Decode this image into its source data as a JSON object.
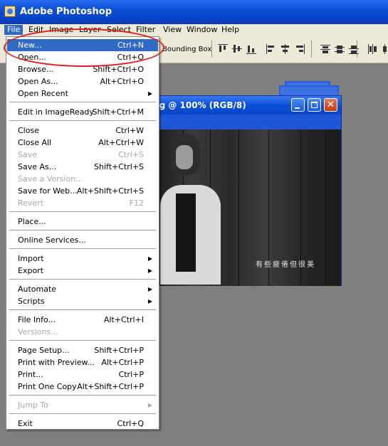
{
  "window": {
    "title": "Adobe Photoshop"
  },
  "menubar": [
    {
      "label": "File"
    },
    {
      "label": "Edit"
    },
    {
      "label": "Image"
    },
    {
      "label": "Layer"
    },
    {
      "label": "Select"
    },
    {
      "label": "Filter"
    },
    {
      "label": "View"
    },
    {
      "label": "Window"
    },
    {
      "label": "Help"
    }
  ],
  "options_bar": {
    "bounding_box_label": "Bounding Box"
  },
  "document": {
    "title": "pg @ 100% (RGB/8)",
    "caption": "有些疲倦但很美"
  },
  "file_menu": [
    {
      "label": "New...",
      "shortcut": "Ctrl+N"
    },
    {
      "label": "Open...",
      "shortcut": "Ctrl+O"
    },
    {
      "label": "Browse...",
      "shortcut": "Shift+Ctrl+O"
    },
    {
      "label": "Open As...",
      "shortcut": "Alt+Ctrl+O"
    },
    {
      "label": "Open Recent",
      "shortcut": ""
    },
    {
      "label": "Edit in ImageReady",
      "shortcut": "Shift+Ctrl+M"
    },
    {
      "label": "Close",
      "shortcut": "Ctrl+W"
    },
    {
      "label": "Close All",
      "shortcut": "Alt+Ctrl+W"
    },
    {
      "label": "Save",
      "shortcut": "Ctrl+S"
    },
    {
      "label": "Save As...",
      "shortcut": "Shift+Ctrl+S"
    },
    {
      "label": "Save a Version...",
      "shortcut": ""
    },
    {
      "label": "Save for Web...",
      "shortcut": "Alt+Shift+Ctrl+S"
    },
    {
      "label": "Revert",
      "shortcut": "F12"
    },
    {
      "label": "Place...",
      "shortcut": ""
    },
    {
      "label": "Online Services...",
      "shortcut": ""
    },
    {
      "label": "Import",
      "shortcut": ""
    },
    {
      "label": "Export",
      "shortcut": ""
    },
    {
      "label": "Automate",
      "shortcut": ""
    },
    {
      "label": "Scripts",
      "shortcut": ""
    },
    {
      "label": "File Info...",
      "shortcut": "Alt+Ctrl+I"
    },
    {
      "label": "Versions...",
      "shortcut": ""
    },
    {
      "label": "Page Setup...",
      "shortcut": "Shift+Ctrl+P"
    },
    {
      "label": "Print with Preview...",
      "shortcut": "Alt+Ctrl+P"
    },
    {
      "label": "Print...",
      "shortcut": "Ctrl+P"
    },
    {
      "label": "Print One Copy",
      "shortcut": "Alt+Shift+Ctrl+P"
    },
    {
      "label": "Jump To",
      "shortcut": ""
    },
    {
      "label": "Exit",
      "shortcut": "Ctrl+Q"
    }
  ],
  "colors": {
    "selection": "#316ac5",
    "titlebar": "#0a4fd6",
    "annotation": "#e02020"
  }
}
